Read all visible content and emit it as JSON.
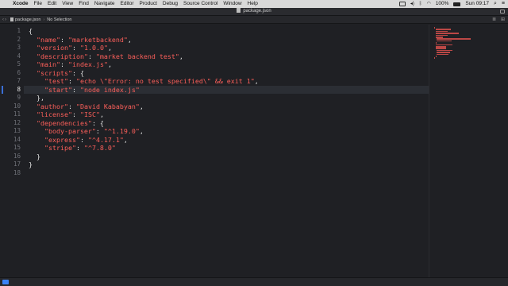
{
  "menubar": {
    "app": "Xcode",
    "menus": [
      "File",
      "Edit",
      "View",
      "Find",
      "Navigate",
      "Editor",
      "Product",
      "Debug",
      "Source Control",
      "Window",
      "Help"
    ],
    "battery": "100%",
    "clock": "Sun 09:17"
  },
  "titlebar": {
    "title": "package.json"
  },
  "jumpbar": {
    "file": "package.json",
    "selection": "No Selection"
  },
  "editor": {
    "current_line": 8,
    "lines": [
      [
        [
          "pun",
          "{"
        ]
      ],
      [
        [
          "pun",
          "  "
        ],
        [
          "key",
          "\"name\""
        ],
        [
          "pun",
          ": "
        ],
        [
          "str",
          "\"marketbackend\""
        ],
        [
          "pun",
          ","
        ]
      ],
      [
        [
          "pun",
          "  "
        ],
        [
          "key",
          "\"version\""
        ],
        [
          "pun",
          ": "
        ],
        [
          "str",
          "\"1.0.0\""
        ],
        [
          "pun",
          ","
        ]
      ],
      [
        [
          "pun",
          "  "
        ],
        [
          "key",
          "\"description\""
        ],
        [
          "pun",
          ": "
        ],
        [
          "str",
          "\"market backend test\""
        ],
        [
          "pun",
          ","
        ]
      ],
      [
        [
          "pun",
          "  "
        ],
        [
          "key",
          "\"main\""
        ],
        [
          "pun",
          ": "
        ],
        [
          "str",
          "\"index.js\""
        ],
        [
          "pun",
          ","
        ]
      ],
      [
        [
          "pun",
          "  "
        ],
        [
          "key",
          "\"scripts\""
        ],
        [
          "pun",
          ": {"
        ]
      ],
      [
        [
          "pun",
          "    "
        ],
        [
          "key",
          "\"test\""
        ],
        [
          "pun",
          ": "
        ],
        [
          "str",
          "\"echo \\\"Error: no test specified\\\" && exit 1\""
        ],
        [
          "pun",
          ","
        ]
      ],
      [
        [
          "pun",
          "    "
        ],
        [
          "key",
          "\"start\""
        ],
        [
          "pun",
          ": "
        ],
        [
          "str",
          "\"node index.js\""
        ]
      ],
      [
        [
          "pun",
          "  },"
        ]
      ],
      [
        [
          "pun",
          "  "
        ],
        [
          "key",
          "\"author\""
        ],
        [
          "pun",
          ": "
        ],
        [
          "str",
          "\"David Kababyan\""
        ],
        [
          "pun",
          ","
        ]
      ],
      [
        [
          "pun",
          "  "
        ],
        [
          "key",
          "\"license\""
        ],
        [
          "pun",
          ": "
        ],
        [
          "str",
          "\"ISC\""
        ],
        [
          "pun",
          ","
        ]
      ],
      [
        [
          "pun",
          "  "
        ],
        [
          "key",
          "\"dependencies\""
        ],
        [
          "pun",
          ": {"
        ]
      ],
      [
        [
          "pun",
          "    "
        ],
        [
          "key",
          "\"body-parser\""
        ],
        [
          "pun",
          ": "
        ],
        [
          "str",
          "\"^1.19.0\""
        ],
        [
          "pun",
          ","
        ]
      ],
      [
        [
          "pun",
          "    "
        ],
        [
          "key",
          "\"express\""
        ],
        [
          "pun",
          ": "
        ],
        [
          "str",
          "\"^4.17.1\""
        ],
        [
          "pun",
          ","
        ]
      ],
      [
        [
          "pun",
          "    "
        ],
        [
          "key",
          "\"stripe\""
        ],
        [
          "pun",
          ": "
        ],
        [
          "str",
          "\"^7.8.0\""
        ]
      ],
      [
        [
          "pun",
          "  }"
        ]
      ],
      [
        [
          "pun",
          "}"
        ]
      ],
      [
        [
          "pun",
          ""
        ]
      ]
    ]
  }
}
